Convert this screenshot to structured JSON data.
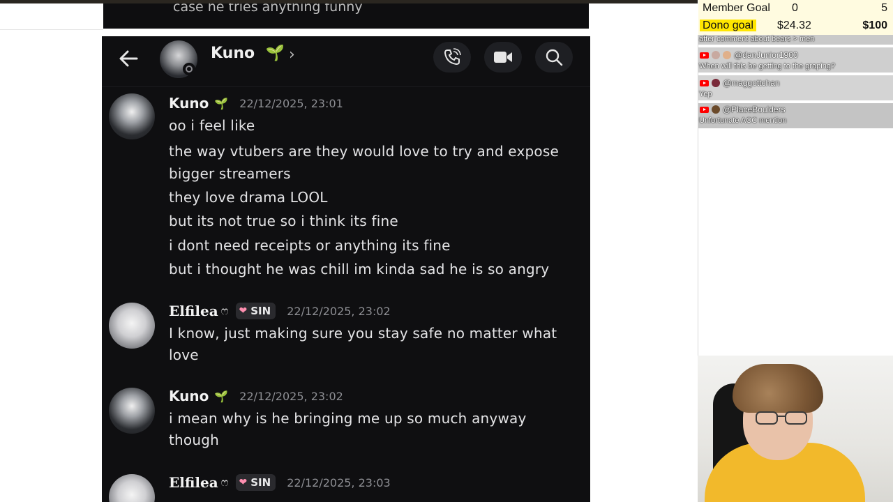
{
  "previous_screenshot": {
    "text": "case he tries anything funny"
  },
  "chat_header": {
    "name": "Kuno",
    "emoji": "🌱",
    "chevron": "›"
  },
  "messages": [
    {
      "user": "Kuno",
      "emoji": "🌱",
      "timestamp": "22/12/2025, 23:01",
      "avatar": "kuno",
      "lines": [
        "oo i feel like",
        "the way vtubers are they would love to try and expose",
        "bigger streamers",
        "they love drama LOOL",
        "but its not true so i think its fine",
        "i dont need receipts or anything its fine",
        "but i thought he was chill im kinda sad he is so angry"
      ]
    },
    {
      "user": "Elfilea",
      "emoji": "ෆ",
      "tag": "SIN",
      "timestamp": "22/12/2025, 23:02",
      "avatar": "elfilea",
      "lines": [
        "I know, just making sure you stay safe no matter what",
        "love"
      ]
    },
    {
      "user": "Kuno",
      "emoji": "🌱",
      "timestamp": "22/12/2025, 23:02",
      "avatar": "kuno",
      "lines": [
        "i mean why is he bringing me up so much anyway",
        "though"
      ]
    },
    {
      "user": "Elfilea",
      "emoji": "ෆ",
      "tag": "SIN",
      "timestamp": "22/12/2025, 23:03",
      "avatar": "elfilea",
      "lines": []
    }
  ],
  "overlay": {
    "member_goal": {
      "label": "Member Goal",
      "current": "0",
      "target": "5"
    },
    "dono_goal": {
      "label": "Dono goal",
      "current": "$24.32",
      "target": "$100"
    },
    "chat": [
      {
        "user": "",
        "text": "after comment about bears > men",
        "platform": "youtube"
      },
      {
        "user": "@danJunior1900",
        "text": "When will this be getting to the graping?",
        "platform": "youtube"
      },
      {
        "user": "@maggottchan",
        "text": "Yep",
        "platform": "youtube"
      },
      {
        "user": "@PlaceBoulders",
        "text": "Unfortunate ACC mention",
        "platform": "youtube"
      }
    ]
  },
  "colors": {
    "chat_bg": "#0f0f11",
    "dono_highlight": "#ffe600",
    "goal_bg": "#fffbe0",
    "youtube_red": "#ff0000",
    "shirt": "#f2b92b"
  },
  "icons": [
    "back-arrow-icon",
    "call-icon",
    "video-icon",
    "search-icon",
    "sprout-icon",
    "heart-icon",
    "youtube-icon"
  ]
}
